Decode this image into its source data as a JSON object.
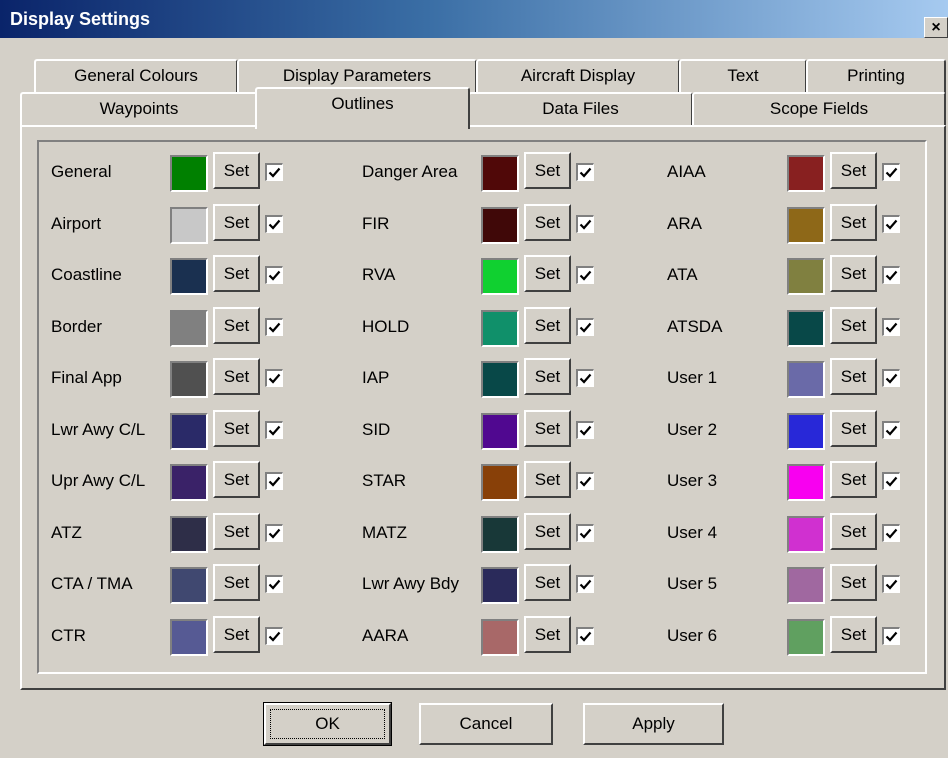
{
  "window": {
    "title": "Display Settings",
    "close_glyph": "×"
  },
  "tabs": {
    "back_row": [
      "General Colours",
      "Display Parameters",
      "Aircraft Display",
      "Text",
      "Printing"
    ],
    "front_row": [
      "Waypoints",
      "Outlines",
      "Data Files",
      "Scope Fields"
    ],
    "active": "Outlines"
  },
  "set_label": "Set",
  "outlines": [
    [
      {
        "label": "General",
        "color": "#008000",
        "checked": true
      },
      {
        "label": "Airport",
        "color": "#c8c8c8",
        "checked": true
      },
      {
        "label": "Coastline",
        "color": "#1a3050",
        "checked": true
      },
      {
        "label": "Border",
        "color": "#808080",
        "checked": true
      },
      {
        "label": "Final App",
        "color": "#505050",
        "checked": true
      },
      {
        "label": "Lwr Awy C/L",
        "color": "#2a2a68",
        "checked": true
      },
      {
        "label": "Upr Awy C/L",
        "color": "#3a2268",
        "checked": true
      },
      {
        "label": "ATZ",
        "color": "#2e2e48",
        "checked": true
      },
      {
        "label": "CTA / TMA",
        "color": "#404870",
        "checked": true
      },
      {
        "label": "CTR",
        "color": "#565a94",
        "checked": true
      }
    ],
    [
      {
        "label": "Danger Area",
        "color": "#500808",
        "checked": true
      },
      {
        "label": "FIR",
        "color": "#400808",
        "checked": true
      },
      {
        "label": "RVA",
        "color": "#10d030",
        "checked": true
      },
      {
        "label": "HOLD",
        "color": "#10906a",
        "checked": true
      },
      {
        "label": "IAP",
        "color": "#084848",
        "checked": true
      },
      {
        "label": "SID",
        "color": "#500890",
        "checked": true
      },
      {
        "label": "STAR",
        "color": "#884008",
        "checked": true
      },
      {
        "label": "MATZ",
        "color": "#183838",
        "checked": true
      },
      {
        "label": "Lwr Awy Bdy",
        "color": "#2a2a5a",
        "checked": true
      },
      {
        "label": "AARA",
        "color": "#a86868",
        "checked": true
      }
    ],
    [
      {
        "label": "AIAA",
        "color": "#882020",
        "checked": true
      },
      {
        "label": "ARA",
        "color": "#8e6818",
        "checked": true
      },
      {
        "label": "ATA",
        "color": "#808040",
        "checked": true
      },
      {
        "label": "ATSDA",
        "color": "#084848",
        "checked": true
      },
      {
        "label": "User 1",
        "color": "#6a6aa8",
        "checked": true
      },
      {
        "label": "User 2",
        "color": "#2828d8",
        "checked": true
      },
      {
        "label": "User 3",
        "color": "#f800f0",
        "checked": true
      },
      {
        "label": "User 4",
        "color": "#d030d0",
        "checked": true
      },
      {
        "label": "User 5",
        "color": "#a068a0",
        "checked": true
      },
      {
        "label": "User 6",
        "color": "#60a060",
        "checked": true
      }
    ]
  ],
  "buttons": {
    "ok": "OK",
    "cancel": "Cancel",
    "apply": "Apply"
  }
}
